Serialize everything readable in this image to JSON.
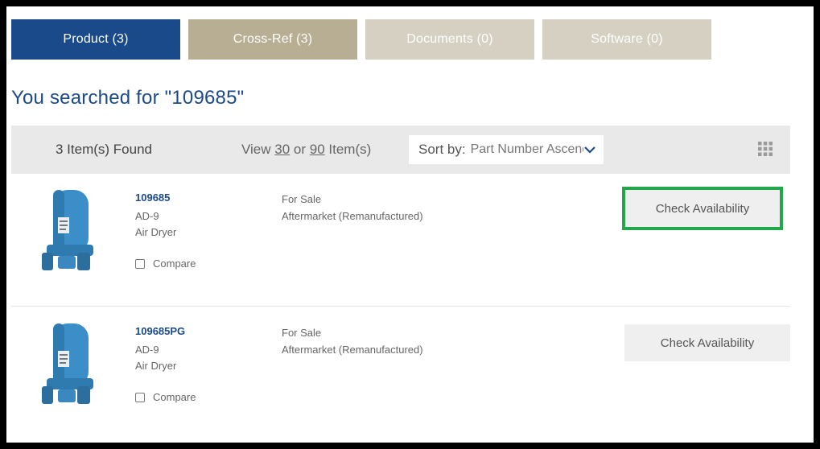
{
  "tabs": [
    {
      "label": "Product (3)",
      "active": true
    },
    {
      "label": "Cross-Ref (3)",
      "active": false
    },
    {
      "label": "Documents (0)",
      "active": false
    },
    {
      "label": "Software (0)",
      "active": false
    }
  ],
  "search": {
    "title": "You searched for \"109685\""
  },
  "toolbar": {
    "found": "3 Item(s) Found",
    "view_prefix": "View ",
    "view_30": "30",
    "view_or": " or ",
    "view_90": "90",
    "view_suffix": " Item(s)",
    "sort_label": "Sort by:",
    "sort_value": "Part Number Ascending",
    "grid_icon": "grid-view-icon"
  },
  "results": [
    {
      "part_number": "109685",
      "model": "AD-9",
      "description": "Air Dryer",
      "compare_label": "Compare",
      "sale": "For Sale",
      "condition": "Aftermarket (Remanufactured)",
      "button": "Check Availability",
      "highlighted": true
    },
    {
      "part_number": "109685PG",
      "model": "AD-9",
      "description": "Air Dryer",
      "compare_label": "Compare",
      "sale": "For Sale",
      "condition": "Aftermarket (Remanufactured)",
      "button": "Check Availability",
      "highlighted": false
    }
  ],
  "colors": {
    "brand_blue": "#1a4a8a",
    "tab_crossref": "#b8ae93",
    "tab_muted": "#d6d0c2",
    "highlight_green": "#22a84a",
    "product_blue": "#3b8ec7"
  }
}
